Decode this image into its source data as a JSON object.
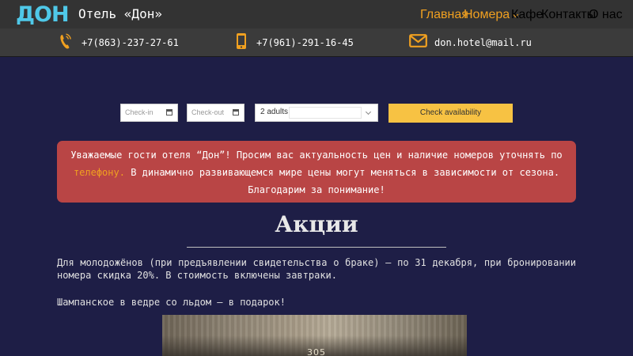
{
  "header": {
    "logo": "ДОН",
    "title": "Отель «Дон»",
    "menu": [
      {
        "label": "Главная",
        "active": true
      },
      {
        "label": "Номера",
        "active": true,
        "has_dropdown": true
      },
      {
        "label": "Кафе",
        "active": false
      },
      {
        "label": "Контакты",
        "active": false
      },
      {
        "label": "О нас",
        "active": false
      }
    ]
  },
  "contacts": {
    "phone1": "+7(863)-237-27-61",
    "phone2": "+7(961)-291-16-45",
    "email": "don.hotel@mail.ru",
    "icons": [
      "phone-ringing-icon",
      "mobile-phone-icon",
      "envelope-icon"
    ]
  },
  "booking": {
    "checkin_placeholder": "Check-in",
    "checkout_placeholder": "Check-out",
    "guests_value": "2 adults",
    "submit_label": "Check availability"
  },
  "notice": {
    "text_before": "Уважаемые гости отеля “Дон”! Просим вас актуальность цен и наличие номеров уточнять по",
    "link": "телефону.",
    "text_after": "В динамично развивающемся мире цены могут меняться в зависимости от сезона. Благодарим за понимание!"
  },
  "content": {
    "heading": "Акции",
    "paragraph1": "Для молодожёнов (при предъявлении свидетельства о браке) — по 31 декабря, при бронировании номера скидка 20%. В стоимость включены завтраки.",
    "paragraph2": "Шампанское в ведре со льдом — в подарок!",
    "photo_label": "305"
  },
  "colors": {
    "background": "#1e1e46",
    "navbar": "#333333",
    "accent": "#f0a020",
    "logo": "#4fc8e8",
    "notice": "#b94545",
    "button": "#f7c243"
  }
}
